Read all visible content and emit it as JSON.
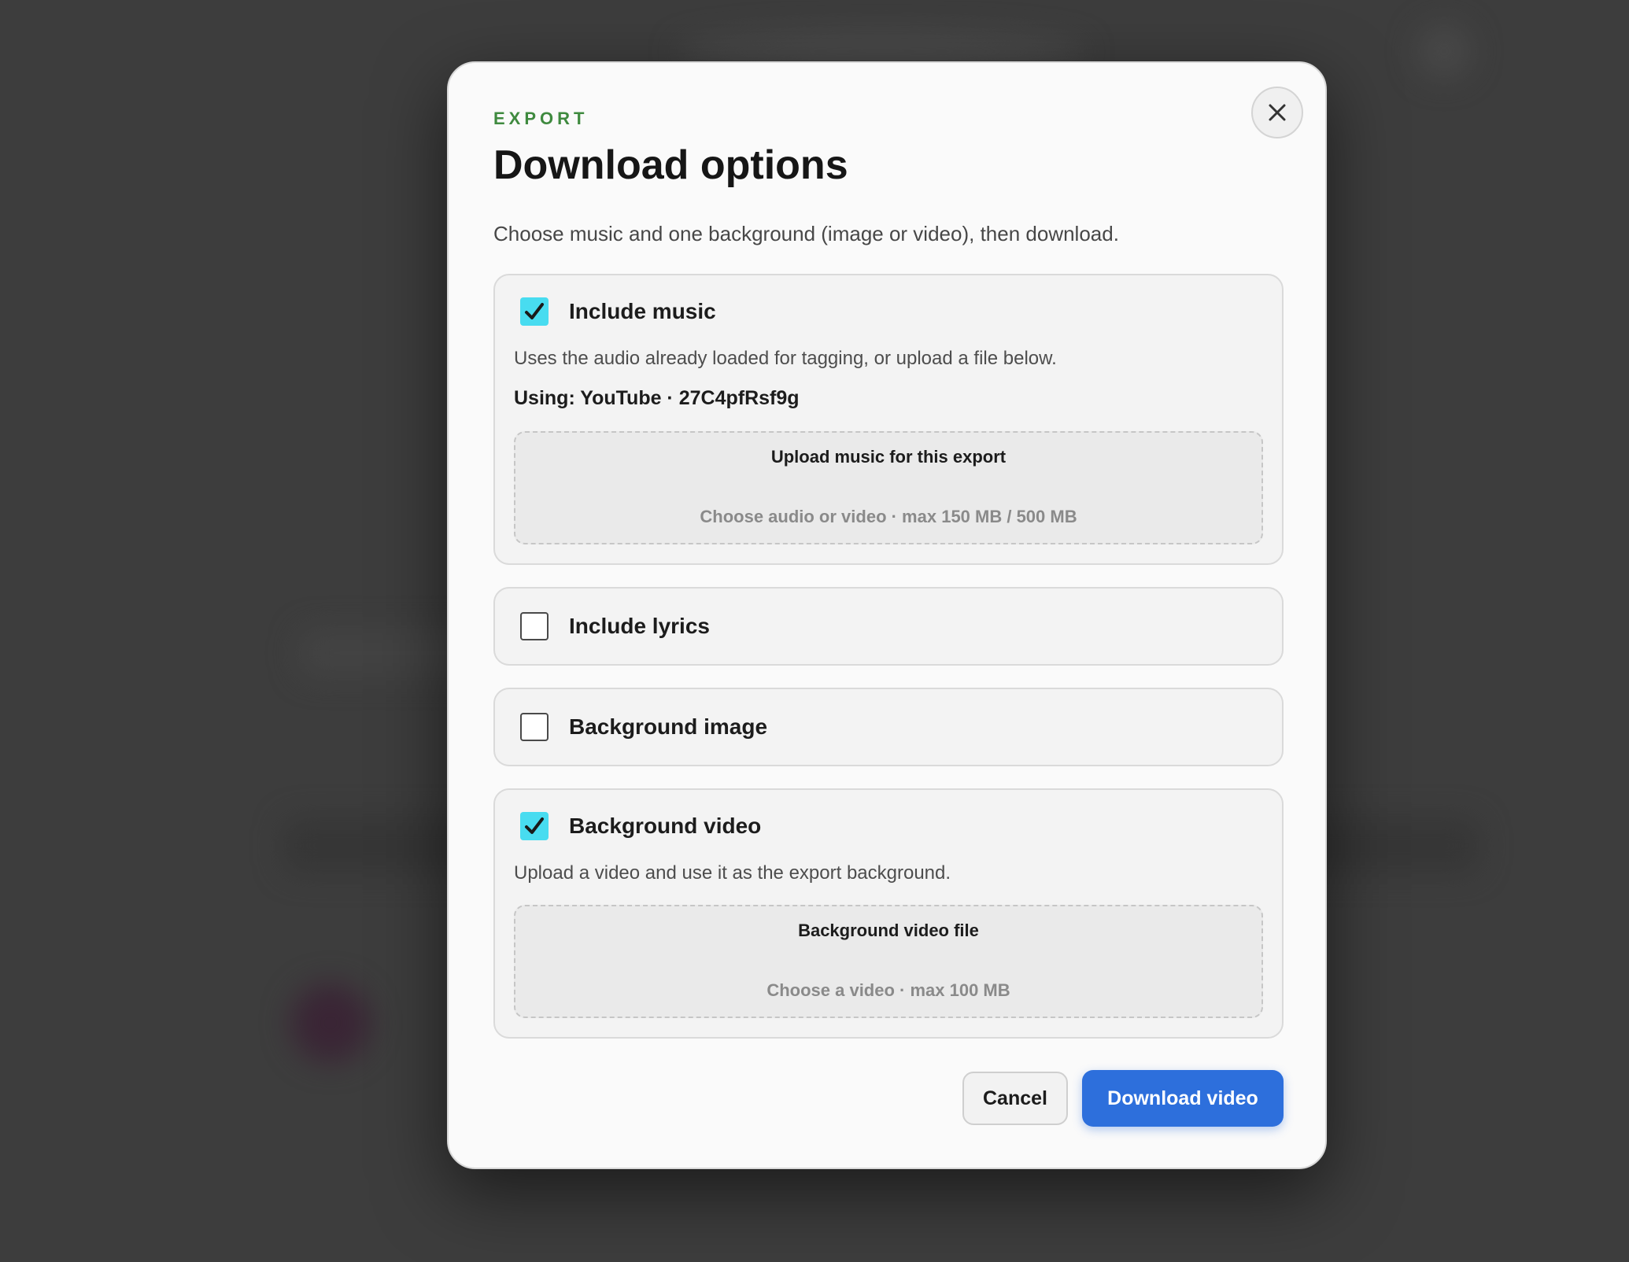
{
  "modal": {
    "eyebrow": "EXPORT",
    "title": "Download options",
    "subtitle": "Choose music and one background (image or video), then download.",
    "close_icon": "close-icon"
  },
  "options": {
    "music": {
      "label": "Include music",
      "checked": true,
      "description": "Uses the audio already loaded for tagging, or upload a file below.",
      "using": "Using: YouTube · 27C4pfRsf9g",
      "upload": {
        "title": "Upload music for this export",
        "hint": "Choose audio or video · max 150 MB / 500 MB"
      }
    },
    "lyrics": {
      "label": "Include lyrics",
      "checked": false
    },
    "background_image": {
      "label": "Background image",
      "checked": false
    },
    "background_video": {
      "label": "Background video",
      "checked": true,
      "description": "Upload a video and use it as the export background.",
      "upload": {
        "title": "Background video file",
        "hint": "Choose a video · max 100 MB"
      }
    }
  },
  "actions": {
    "cancel_label": "Cancel",
    "download_label": "Download video"
  },
  "colors": {
    "accent_green": "#3f8a3f",
    "checkbox_checked": "#48dcf0",
    "primary_button": "#2d6fdc",
    "backdrop": "#3d3d3d"
  }
}
